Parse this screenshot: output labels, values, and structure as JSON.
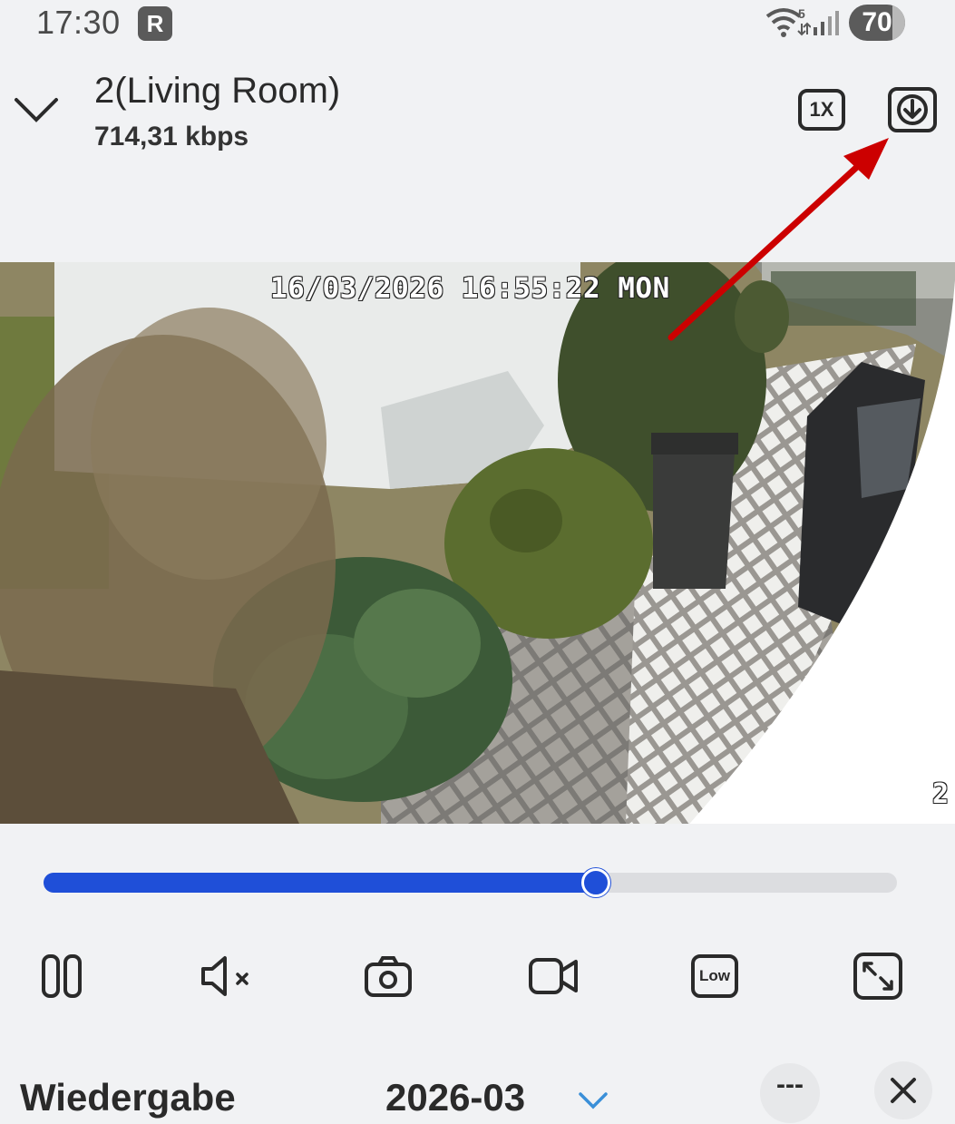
{
  "status_bar": {
    "time": "17:30",
    "app_badge": "R",
    "wifi_label": "5",
    "battery": "70",
    "icons": [
      "wifi-icon",
      "signal-icon",
      "battery-icon"
    ]
  },
  "header": {
    "title": "2(Living Room)",
    "bitrate": "714,31 kbps",
    "speed_label": "1X",
    "icons": [
      "chevron-down-icon",
      "download-icon"
    ]
  },
  "annotation": {
    "arrow_color": "#cc0000"
  },
  "video": {
    "osd_timestamp": "16/03/2026 16:55:22 MON",
    "osd_channel": "2"
  },
  "playback": {
    "progress": 0.647,
    "accent_color": "#1f4fd8"
  },
  "controls": {
    "quality_label": "Low",
    "icons": [
      "pause-icon",
      "mute-icon",
      "snapshot-icon",
      "record-icon",
      "quality-icon",
      "fullscreen-icon"
    ]
  },
  "bottom_bar": {
    "title": "Wiedergabe",
    "month": "2026-03",
    "more_label": "---",
    "icons": [
      "chevron-down-icon",
      "close-icon"
    ]
  }
}
